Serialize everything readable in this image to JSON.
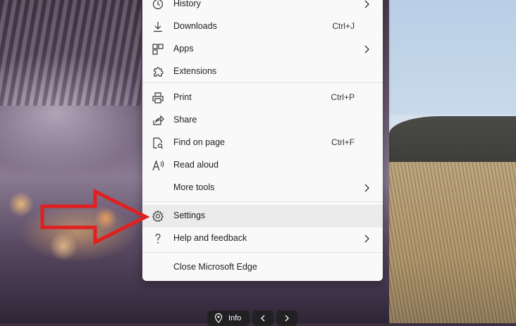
{
  "menu": {
    "items": [
      {
        "label": "History",
        "shortcut": "",
        "submenu": true,
        "icon": "history-icon"
      },
      {
        "label": "Downloads",
        "shortcut": "Ctrl+J",
        "submenu": false,
        "icon": "download-icon"
      },
      {
        "label": "Apps",
        "shortcut": "",
        "submenu": true,
        "icon": "apps-icon"
      },
      {
        "label": "Extensions",
        "shortcut": "",
        "submenu": false,
        "icon": "puzzle-icon"
      },
      {
        "label": "Print",
        "shortcut": "Ctrl+P",
        "submenu": false,
        "icon": "printer-icon"
      },
      {
        "label": "Share",
        "shortcut": "",
        "submenu": false,
        "icon": "share-icon"
      },
      {
        "label": "Find on page",
        "shortcut": "Ctrl+F",
        "submenu": false,
        "icon": "find-on-page-icon"
      },
      {
        "label": "Read aloud",
        "shortcut": "",
        "submenu": false,
        "icon": "read-aloud-icon"
      },
      {
        "label": "More tools",
        "shortcut": "",
        "submenu": true,
        "icon": ""
      },
      {
        "label": "Settings",
        "shortcut": "",
        "submenu": false,
        "icon": "gear-icon",
        "highlighted": true
      },
      {
        "label": "Help and feedback",
        "shortcut": "",
        "submenu": true,
        "icon": "question-icon"
      },
      {
        "label": "Close Microsoft Edge",
        "shortcut": "",
        "submenu": false,
        "icon": ""
      }
    ]
  },
  "bottom_bar": {
    "info_label": "Info"
  },
  "colors": {
    "menu_bg": "#f9f9f9",
    "highlight_bg": "#ebebeb",
    "arrow_red": "#e02020"
  }
}
